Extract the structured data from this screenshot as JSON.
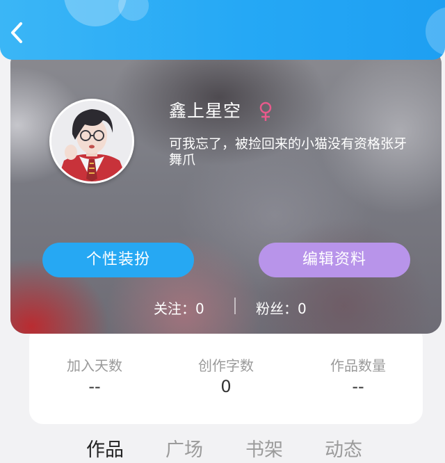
{
  "header": {
    "back_icon": "chevron-left-icon",
    "color": "#25a8f5"
  },
  "profile": {
    "username": "鑫上星空",
    "gender_icon": "female-symbol-icon",
    "gender_color": "#e85a8c",
    "bio": "可我忘了，被捡回来的小猫没有资格张牙舞爪",
    "actions": {
      "dress_up_label": "个性装扮",
      "dress_up_color": "#26a8f3",
      "edit_profile_label": "编辑资料",
      "edit_profile_color": "#b894ea"
    },
    "following_label": "关注：0",
    "fans_label": "粉丝：0"
  },
  "stats": [
    {
      "label": "加入天数",
      "value": "--"
    },
    {
      "label": "创作字数",
      "value": "0"
    },
    {
      "label": "作品数量",
      "value": "--"
    }
  ],
  "tabs": [
    {
      "label": "作品",
      "active": true
    },
    {
      "label": "广场",
      "active": false
    },
    {
      "label": "书架",
      "active": false
    },
    {
      "label": "动态",
      "active": false
    }
  ]
}
